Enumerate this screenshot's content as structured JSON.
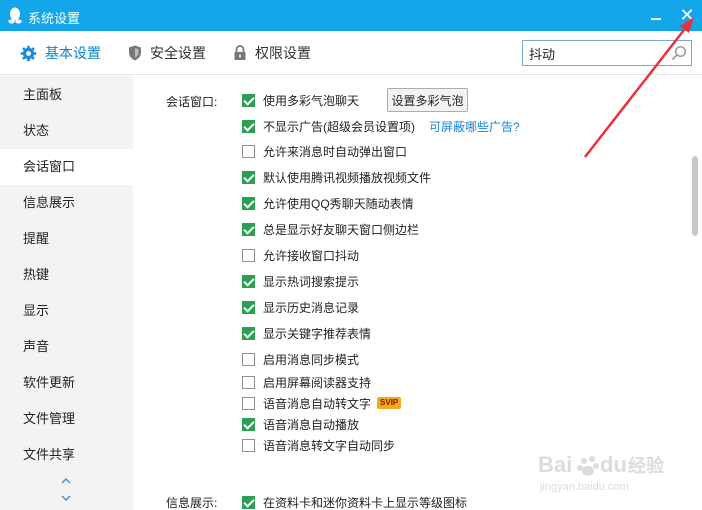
{
  "window": {
    "title": "系统设置"
  },
  "tabs": [
    {
      "label": "基本设置",
      "icon": "gear-icon",
      "active": true
    },
    {
      "label": "安全设置",
      "icon": "shield-icon",
      "active": false
    },
    {
      "label": "权限设置",
      "icon": "lock-icon",
      "active": false
    }
  ],
  "search": {
    "value": "抖动",
    "placeholder": ""
  },
  "sidebar": {
    "items": [
      {
        "label": "主面板"
      },
      {
        "label": "状态"
      },
      {
        "label": "会话窗口",
        "active": true
      },
      {
        "label": "信息展示"
      },
      {
        "label": "提醒"
      },
      {
        "label": "热键"
      },
      {
        "label": "显示"
      },
      {
        "label": "声音"
      },
      {
        "label": "软件更新"
      },
      {
        "label": "文件管理"
      },
      {
        "label": "文件共享"
      }
    ]
  },
  "session_window": {
    "label": "会话窗口:",
    "button_label": "设置多彩气泡",
    "link_label": "可屏蔽哪些广告?",
    "badge_label": "SVIP",
    "options": [
      {
        "label": "使用多彩气泡聊天",
        "checked": true
      },
      {
        "label": "不显示广告(超级会员设置项)",
        "checked": true
      },
      {
        "label": "允许来消息时自动弹出窗口",
        "checked": false
      },
      {
        "label": "默认使用腾讯视频播放视频文件",
        "checked": true
      },
      {
        "label": "允许使用QQ秀聊天随动表情",
        "checked": true
      },
      {
        "label": "总是显示好友聊天窗口侧边栏",
        "checked": true
      },
      {
        "label": "允许接收窗口抖动",
        "checked": false
      },
      {
        "label": "显示热词搜索提示",
        "checked": true
      },
      {
        "label": "显示历史消息记录",
        "checked": true
      },
      {
        "label": "显示关键字推荐表情",
        "checked": true
      },
      {
        "label": "启用消息同步模式",
        "checked": false
      },
      {
        "label": "启用屏幕阅读器支持",
        "checked": false
      },
      {
        "label": "语音消息自动转文字",
        "checked": false
      },
      {
        "label": "语音消息自动播放",
        "checked": true
      },
      {
        "label": "语音消息转文字自动同步",
        "checked": false
      }
    ]
  },
  "info_display": {
    "label": "信息展示:",
    "options": [
      {
        "label": "在资料卡和迷你资料卡上显示等级图标",
        "checked": true
      }
    ]
  },
  "watermark": {
    "brand": "Bai",
    "brand_suffix": "du",
    "cn": "经验",
    "url": "jingyan.baidu.com"
  },
  "colors": {
    "titlebar": "#14a6ea",
    "check": "#2aa152",
    "link": "#1a82d8",
    "annotation_arrow": "#e8313a"
  }
}
